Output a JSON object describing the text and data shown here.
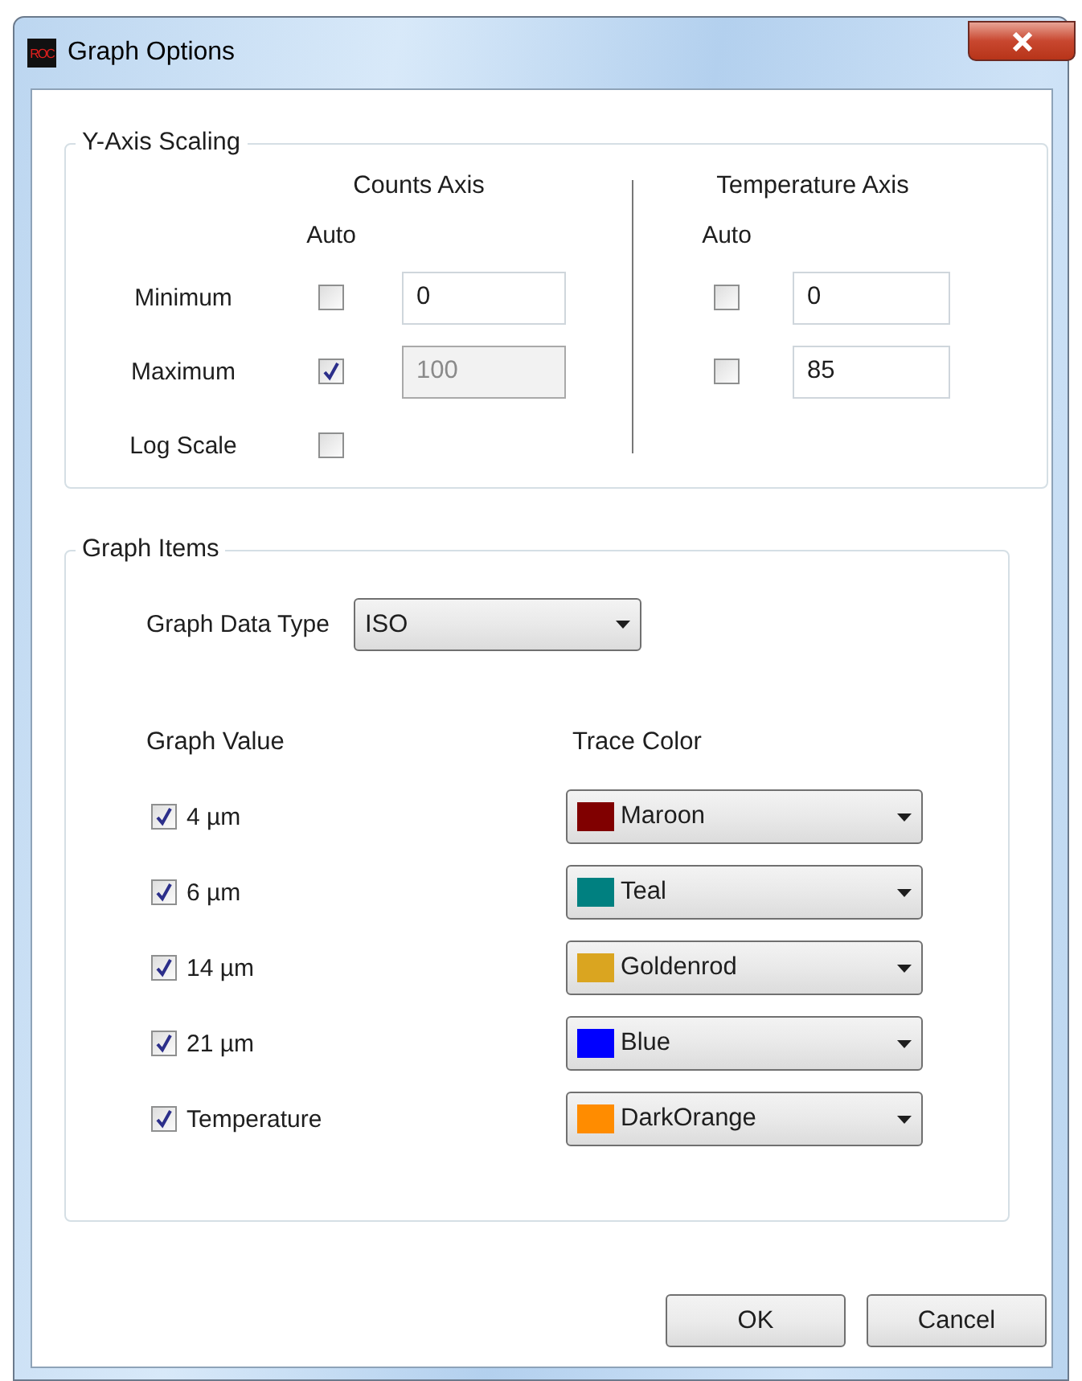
{
  "window": {
    "title": "Graph Options",
    "app_icon_text": "ROC"
  },
  "y_axis_scaling": {
    "title": "Y-Axis Scaling",
    "row_labels": [
      "Minimum",
      "Maximum",
      "Log Scale"
    ],
    "counts_axis": {
      "header": "Counts Axis",
      "auto_label": "Auto",
      "rows": [
        {
          "auto_checked": false,
          "value": "0",
          "disabled": false
        },
        {
          "auto_checked": true,
          "value": "100",
          "disabled": true
        },
        {
          "auto_checked": false
        }
      ]
    },
    "temperature_axis": {
      "header": "Temperature Axis",
      "auto_label": "Auto",
      "rows": [
        {
          "auto_checked": false,
          "value": "0",
          "disabled": false
        },
        {
          "auto_checked": false,
          "value": "85",
          "disabled": false
        }
      ]
    }
  },
  "graph_items": {
    "title": "Graph Items",
    "data_type_label": "Graph Data Type",
    "data_type_value": "ISO",
    "value_header": "Graph Value",
    "color_header": "Trace Color",
    "items": [
      {
        "label": "4 µm",
        "checked": true,
        "color_name": "Maroon",
        "color": "#800000"
      },
      {
        "label": "6 µm",
        "checked": true,
        "color_name": "Teal",
        "color": "#008080"
      },
      {
        "label": "14 µm",
        "checked": true,
        "color_name": "Goldenrod",
        "color": "#daa520"
      },
      {
        "label": "21 µm",
        "checked": true,
        "color_name": "Blue",
        "color": "#0000ff"
      },
      {
        "label": "Temperature",
        "checked": true,
        "color_name": "DarkOrange",
        "color": "#ff8c00"
      }
    ]
  },
  "buttons": [
    "OK",
    "Cancel"
  ]
}
